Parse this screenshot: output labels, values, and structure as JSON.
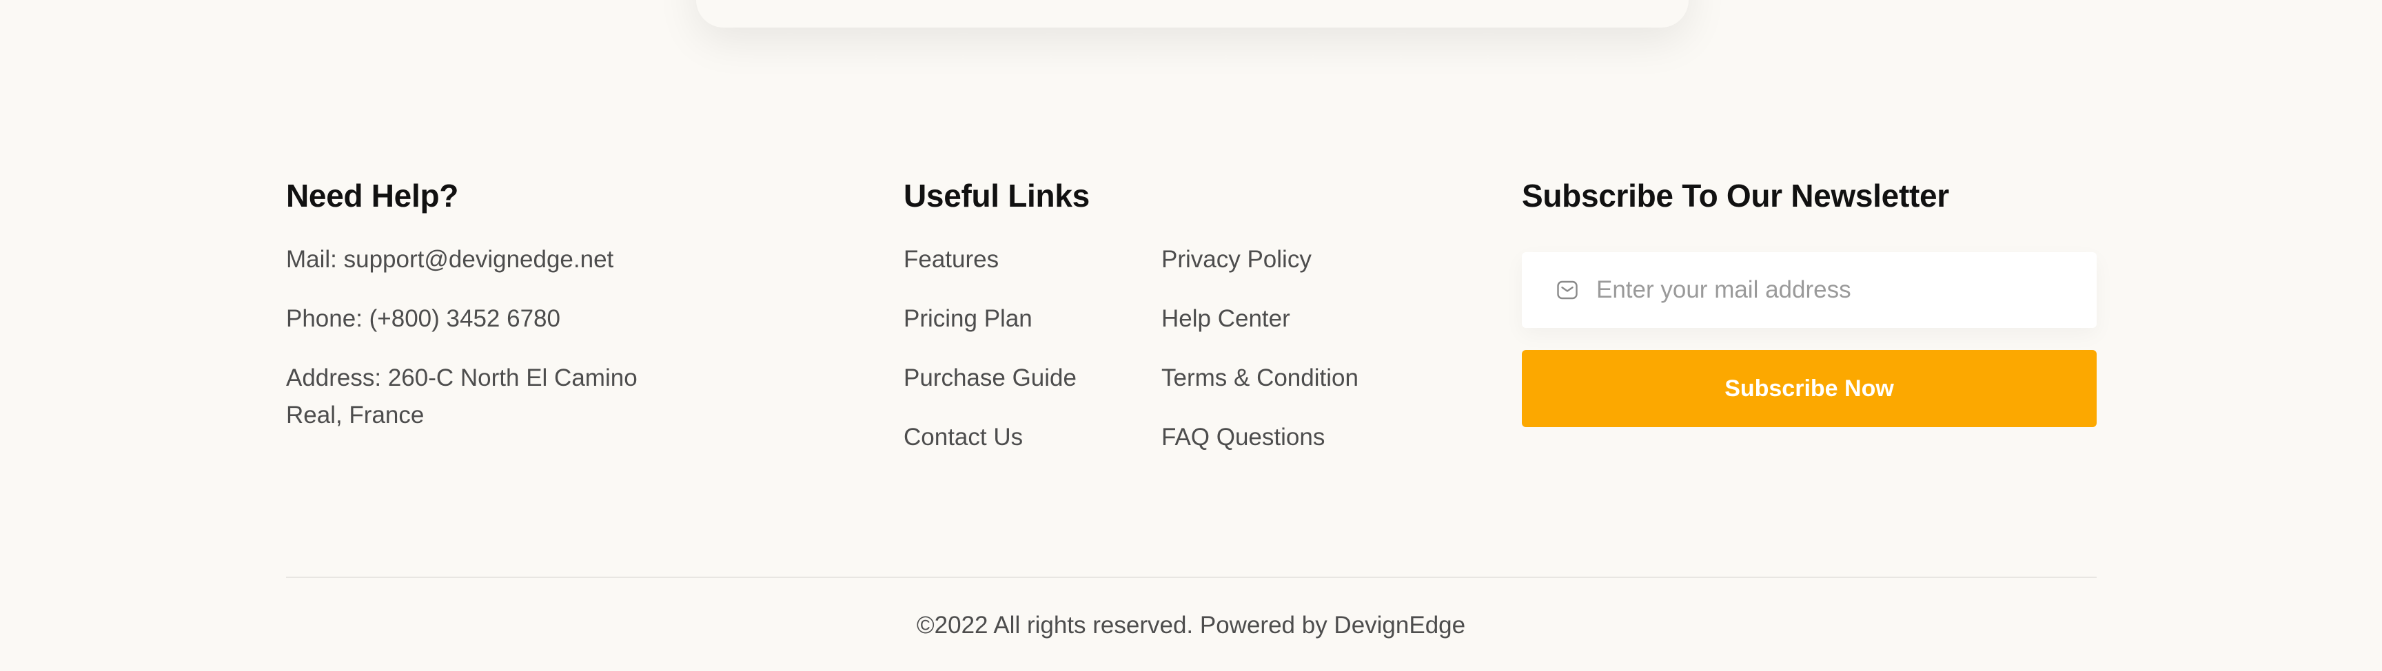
{
  "help": {
    "title": "Need Help?",
    "mail": "Mail: support@devignedge.net",
    "phone": "Phone: (+800) 3452 6780",
    "address_line1": "Address: 260-C North El Camino",
    "address_line2": "Real, France"
  },
  "links": {
    "title": "Useful Links",
    "col1": [
      "Features",
      "Pricing Plan",
      "Purchase Guide",
      "Contact Us"
    ],
    "col2": [
      "Privacy Policy",
      "Help Center",
      "Terms & Condition",
      "FAQ Questions"
    ]
  },
  "newsletter": {
    "title": "Subscribe To Our Newsletter",
    "placeholder": "Enter your mail address",
    "value": "",
    "button_label": "Subscribe Now",
    "icon": "mail-icon"
  },
  "footer": {
    "copyright": "©2022 All rights reserved. Powered by DevignEdge"
  },
  "colors": {
    "background": "#fbf9f5",
    "accent": "#fca800",
    "heading": "#111111",
    "text": "#4d4d4d"
  }
}
